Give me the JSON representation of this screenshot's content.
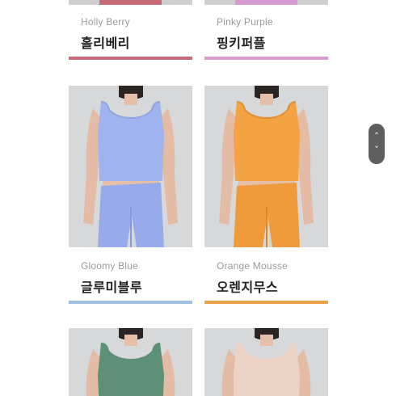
{
  "products": [
    {
      "en_name": "Holly Berry",
      "ko_name": "홀리베리",
      "color": "#c66a78"
    },
    {
      "en_name": "Pinky Purple",
      "ko_name": "핑키퍼플",
      "color": "#d79ad0"
    },
    {
      "en_name": "Gloomy Blue",
      "ko_name": "글루미블루",
      "color": "#9fbee0"
    },
    {
      "en_name": "Orange Mousse",
      "ko_name": "오렌지무스",
      "color": "#eba04a"
    },
    {
      "en_name": "",
      "ko_name": "",
      "color": "#5e8f77"
    },
    {
      "en_name": "",
      "ko_name": "",
      "color": "#edd3c6"
    }
  ],
  "scroll_widget": {
    "up_icon": "chevron-up-icon",
    "down_icon": "chevron-down-icon"
  }
}
